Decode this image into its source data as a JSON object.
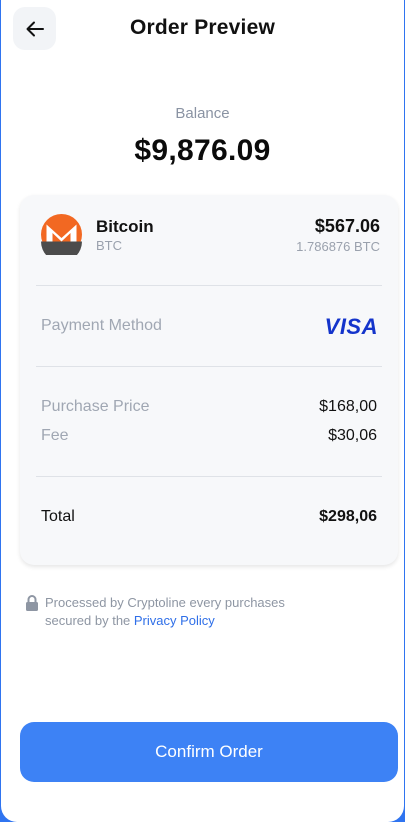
{
  "header": {
    "title": "Order Preview",
    "back_icon": "arrow-left-icon"
  },
  "balance": {
    "label": "Balance",
    "value": "$9,876.09"
  },
  "asset": {
    "name": "Bitcoin",
    "symbol": "BTC",
    "value": "$567.06",
    "amount": "1.786876 BTC",
    "icon": "monero-logo-icon"
  },
  "payment": {
    "label": "Payment Method",
    "provider": "VISA"
  },
  "pricing": {
    "purchase_label": "Purchase Price",
    "purchase_value": "$168,00",
    "fee_label": "Fee",
    "fee_value": "$30,06"
  },
  "total": {
    "label": "Total",
    "value": "$298,06"
  },
  "note": {
    "icon": "lock-icon",
    "text_line1": "Processed by Cryptoline every purchases",
    "text_line2_prefix": "secured by the ",
    "link": "Privacy Policy"
  },
  "actions": {
    "confirm_label": "Confirm Order"
  },
  "colors": {
    "accent": "#3d82f5",
    "visa": "#1434cb",
    "link": "#2f6fe8",
    "monero_orange": "#f26822"
  }
}
